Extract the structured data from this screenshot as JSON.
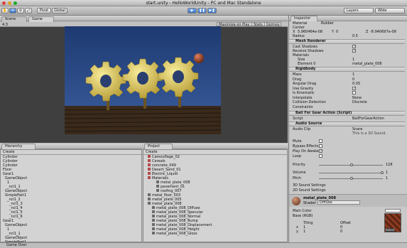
{
  "window": {
    "title": "start.unity - HelloWorldUnity - PC and Mac Standalone"
  },
  "toolbar": {
    "tools": [
      "hand",
      "move",
      "rotate",
      "scale"
    ],
    "pivot_label": "Pivot",
    "global_label": "Global",
    "layers_label": "Layers",
    "layout_label": "Wide"
  },
  "tabs": {
    "scene": "Scene",
    "game": "Game",
    "inspector": "Inspector",
    "hierarchy": "Hierarchy",
    "project": "Project"
  },
  "game_view": {
    "aspect": "4:3",
    "buttons": [
      "Maximize on Play",
      "Stats",
      "Gizmos"
    ]
  },
  "hierarchy": {
    "create_label": "Create",
    "items": [
      "Cylinder",
      "Cylinder",
      "Cylinder",
      "Floor",
      "Gear1",
      "GameObject",
      "1",
      "_ncl1_1",
      "GameObject",
      "SimplePart1",
      "_ncl1_2",
      "_ncl1_3",
      "_ncl1_4",
      "_ncl1_5",
      "_ncl1_6",
      "Gear1",
      "GameObject",
      "1",
      "_ncl1_1",
      "GameObject",
      "SimplePart1"
    ]
  },
  "project": {
    "create_label": "Create",
    "items": [
      "Camouflage_02",
      "Cereals",
      "concrete_049",
      "Desert_Sand_01",
      "Electric_Liquid",
      "Materials",
      "metal_plate_008",
      "pavement_01",
      "roofing_007",
      "metal_floor_003",
      "metal_plate_005",
      "metal_plate_008",
      "metal_plate_008_Diffuse",
      "metal_plate_008_Specular",
      "metal_plate_008_Normal",
      "metal_plate_008_Bump",
      "metal_plate_008_Displacement",
      "metal_plate_008_Height",
      "metal_plate_008_Gloss"
    ]
  },
  "inspector": {
    "header_field": "Material",
    "header_value": "Rubber",
    "center_label": "Center",
    "center": {
      "x": "5.960464e-08",
      "y": "0",
      "z": "-8.940697e-08"
    },
    "radius_label": "Radius",
    "radius": "0.5",
    "mesh_renderer": {
      "title": "Mesh Renderer",
      "cast_shadows": "Cast Shadows",
      "receive_shadows": "Receive Shadows",
      "materials": "Materials",
      "size_label": "Size",
      "size": "1",
      "element_label": "Element 0",
      "element": "metal_plate_008"
    },
    "rigidbody": {
      "title": "Rigidbody",
      "rows": [
        {
          "k": "Mass",
          "v": "1"
        },
        {
          "k": "Drag",
          "v": "0"
        },
        {
          "k": "Angular Drag",
          "v": "0.05"
        },
        {
          "k": "Use Gravity",
          "v": ""
        },
        {
          "k": "Is Kinematic",
          "v": ""
        },
        {
          "k": "Interpolate",
          "v": "None"
        },
        {
          "k": "Collision Detection",
          "v": "Discrete"
        },
        {
          "k": "Constraints",
          "v": ""
        }
      ]
    },
    "script": {
      "title": "Ball For Gear Action (Script)",
      "script_label": "Script",
      "script_value": "BallForGearAction"
    },
    "audio": {
      "title": "Audio Source",
      "clip_label": "Audio Clip",
      "clip_value": "Snare",
      "note": "This is a 3D Sound.",
      "rows": [
        {
          "k": "Mute"
        },
        {
          "k": "Bypass Effects"
        },
        {
          "k": "Play On Awake"
        },
        {
          "k": "Loop"
        }
      ],
      "priority_label": "Priority",
      "priority": "128",
      "volume_label": "Volume",
      "volume": "1",
      "pitch_label": "Pitch",
      "pitch": "1",
      "sound3d": "3D Sound Settings",
      "sound2d": "2D Sound Settings"
    },
    "material": {
      "name": "metal_plate_008",
      "shader_label": "Shader",
      "shader": "Diffuse",
      "main_color": "Main Color",
      "base_label": "Base (RGB)",
      "tiling": "Tiling",
      "offset": "Offset",
      "x": "x",
      "y": "y",
      "tx": "1",
      "ty": "1",
      "ox": "0",
      "oy": "0",
      "select": "Select"
    }
  },
  "status": {
    "text": "Game Over"
  },
  "colors": {
    "sky": "#1e3a72",
    "gear": "#e3d266",
    "floor": "#3a2a1c"
  }
}
